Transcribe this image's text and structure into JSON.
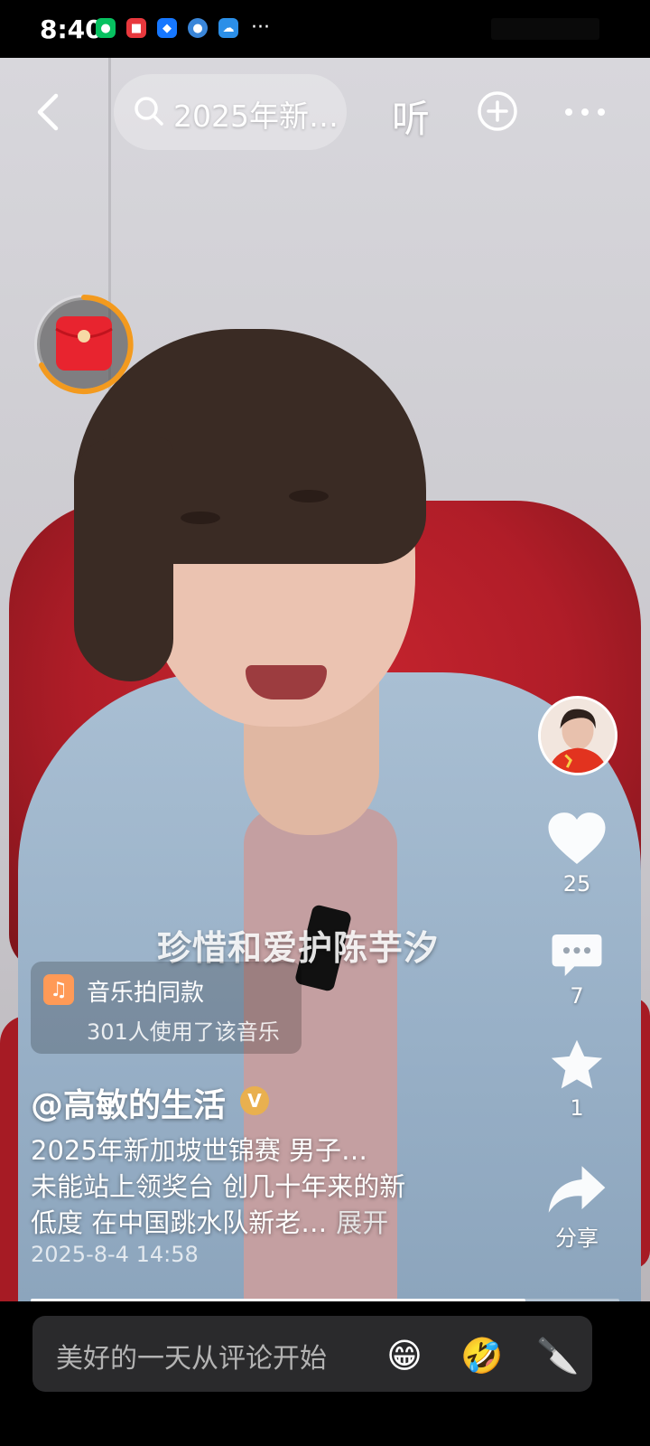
{
  "status_bar": {
    "time": "8:40",
    "more": "···"
  },
  "nav": {
    "search_text": "2025年新…",
    "listen_label": "听"
  },
  "video": {
    "caption_overlay": "珍惜和爱护陈芋汐",
    "progress": 0.84
  },
  "music": {
    "title": "音乐拍同款",
    "subtitle": "301人使用了该音乐"
  },
  "post": {
    "author": "@高敏的生活",
    "verified_mark": "V",
    "desc_line1": "2025年新加坡世锦赛 男子…",
    "desc_line2": "未能站上领奖台 创几十年来的新",
    "desc_line3": "低度 在中国跳水队新老…",
    "expand_label": "展开",
    "date": "2025-8-4 14:58"
  },
  "actions": {
    "likes": "25",
    "comments": "7",
    "favorites": "1",
    "share_label": "分享"
  },
  "comment_bar": {
    "placeholder": "美好的一天从评论开始",
    "emoji1": "😁",
    "emoji2": "🤣",
    "emoji3": "🔪"
  },
  "colors": {
    "accent_orange": "#f39a1e",
    "red_packet": "#e8242f",
    "verified": "#e9b04f"
  }
}
